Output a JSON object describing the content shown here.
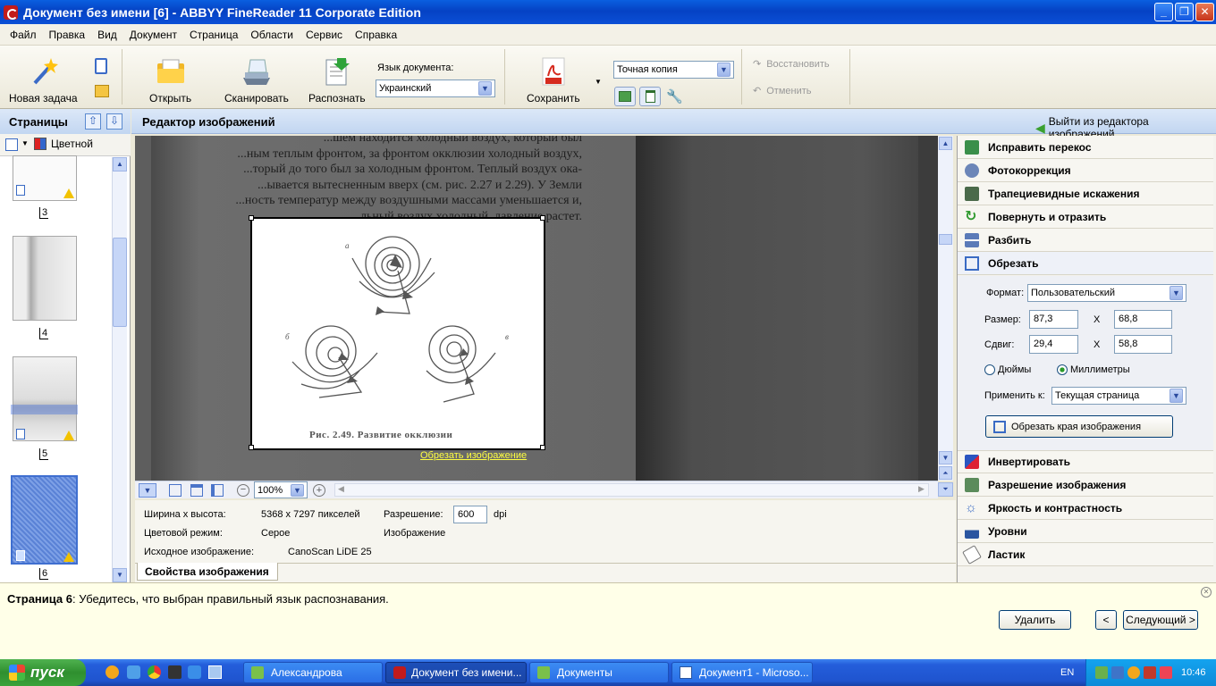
{
  "window": {
    "title": "Документ без имени [6] - ABBYY FineReader 11 Corporate Edition"
  },
  "menu": [
    "Файл",
    "Правка",
    "Вид",
    "Документ",
    "Страница",
    "Области",
    "Сервис",
    "Справка"
  ],
  "toolbar": {
    "new_task": "Новая задача",
    "open": "Открыть",
    "scan": "Сканировать",
    "recognize": "Распознать",
    "doc_lang_label": "Язык документа:",
    "doc_lang_value": "Украинский",
    "save": "Сохранить",
    "save_mode": "Точная копия",
    "restore": "Восстановить",
    "undo": "Отменить"
  },
  "pages_panel": {
    "title": "Страницы",
    "color_mode": "Цветной",
    "pages": [
      "3",
      "4",
      "5",
      "6"
    ]
  },
  "editor": {
    "title": "Редактор изображений",
    "exit_label": "Выйти из редактора изображений",
    "crop_link": "Обрезать изображение",
    "zoom": "100%",
    "scan_text": [
      "     ...шем находится холодный воздух, который был",
      "...ным теплым фронтом, за фронтом окклюзии холодный воздух,",
      "...торый до того был за холодным фронтом. Теплый воздух ока-",
      "...ывается вытесненным вверх (см. рис. 2.27 и 2.29). У Земли",
      "...ность температур между воздушными массами уменьшается и,",
      "...льный воздух холодный, давление растет."
    ],
    "figure_caption": "Рис. 2.49. Развитие окклюзии",
    "figure_labels": [
      "а",
      "б",
      "в"
    ]
  },
  "right_panel": {
    "tools_top": [
      "Исправить перекос",
      "Фотокоррекция",
      "Трапециевидные искажения",
      "Повернуть и отразить",
      "Разбить",
      "Обрезать"
    ],
    "crop": {
      "format_label": "Формат:",
      "format_value": "Пользовательский",
      "size_label": "Размер:",
      "size_w": "87,3",
      "size_h": "68,8",
      "offset_label": "Сдвиг:",
      "offset_x": "29,4",
      "offset_y": "58,8",
      "x_sep": "X",
      "unit_inches": "Дюймы",
      "unit_mm": "Миллиметры",
      "apply_label": "Применить к:",
      "apply_value": "Текущая страница",
      "crop_button": "Обрезать края изображения"
    },
    "tools_bottom": [
      "Инвертировать",
      "Разрешение изображения",
      "Яркость и контрастность",
      "Уровни",
      "Ластик"
    ]
  },
  "properties": {
    "size_label": "Ширина x высота:",
    "size_value": "5368 x 7297 пикселей",
    "res_label": "Разрешение:",
    "res_value": "600",
    "res_unit": "dpi",
    "color_label": "Цветовой режим:",
    "color_value": "Серое",
    "image_label": "Изображение",
    "source_label": "Исходное изображение:",
    "source_value": "CanoScan LiDE 25",
    "tab": "Свойства изображения"
  },
  "hint": {
    "page_label": "Страница 6",
    "message": ": Убедитесь, что выбран правильный язык распознавания.",
    "delete": "Удалить",
    "prev": "<",
    "next": "Следующий >"
  },
  "taskbar": {
    "start": "пуск",
    "items": [
      "Александрова",
      "Документ без имени...",
      "Документы",
      "Документ1 - Microso..."
    ],
    "lang": "EN",
    "clock": "10:46"
  }
}
